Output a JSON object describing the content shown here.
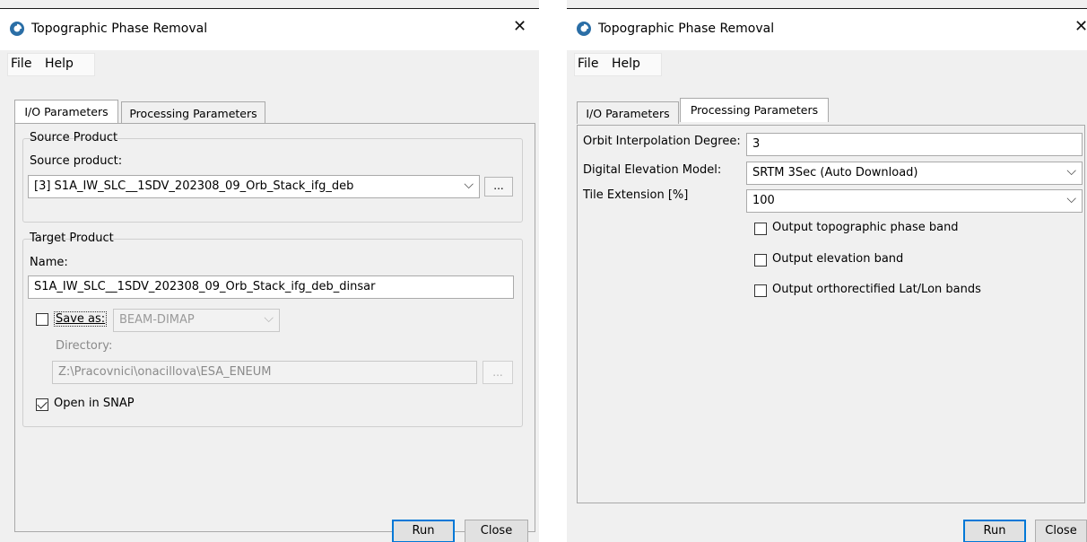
{
  "left": {
    "title": "Topographic Phase Removal",
    "menu": [
      "File",
      "Help"
    ],
    "tabs": [
      "I/O Parameters",
      "Processing Parameters"
    ],
    "source_group": "Source Product",
    "source_label": "Source product:",
    "source_value": "[3] S1A_IW_SLC__1SDV_202308_09_Orb_Stack_ifg_deb",
    "browse": "...",
    "target_group": "Target Product",
    "name_label": "Name:",
    "name_value": "S1A_IW_SLC__1SDV_202308_09_Orb_Stack_ifg_deb_dinsar",
    "save_as_label": "Save as:",
    "save_as_checked": false,
    "format_value": "BEAM-DIMAP",
    "directory_label": "Directory:",
    "directory_value": "Z:\\Pracovnici\\onacillova\\ESA_ENEUM",
    "open_in_snap_label": "Open in SNAP",
    "open_in_snap_checked": true,
    "run": "Run",
    "close": "Close"
  },
  "right": {
    "title": "Topographic Phase Removal",
    "menu": [
      "File",
      "Help"
    ],
    "tabs": [
      "I/O Parameters",
      "Processing Parameters"
    ],
    "orbit_label": "Orbit Interpolation Degree:",
    "orbit_value": "3",
    "dem_label": "Digital Elevation Model:",
    "dem_value": "SRTM 3Sec (Auto Download)",
    "tile_label": "Tile Extension [%]",
    "tile_value": "100",
    "opt_topo": "Output topographic phase band",
    "opt_elev": "Output elevation band",
    "opt_ortho": "Output orthorectified Lat/Lon bands",
    "run": "Run",
    "close": "Close"
  },
  "icons": {
    "app": "snap-app-icon",
    "close": "close-icon",
    "dropdown": "chevron-down-icon"
  },
  "colors": {
    "default_button_border": "#0078d7",
    "window_bg": "#f0f0f0"
  }
}
